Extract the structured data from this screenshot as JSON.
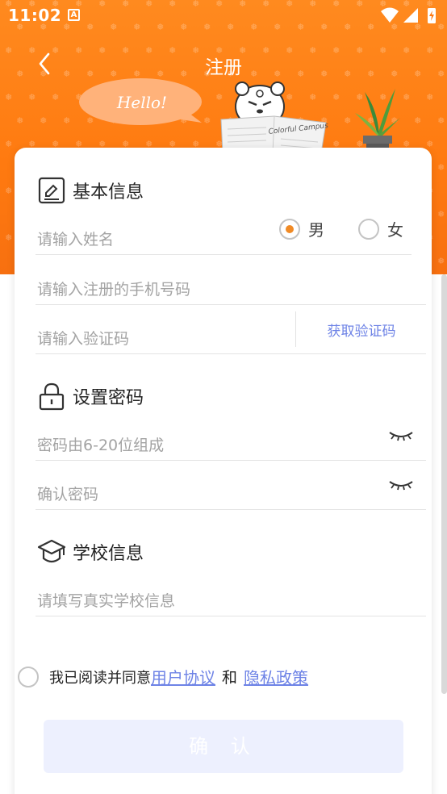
{
  "status_bar": {
    "time": "11:02",
    "app_icon_letter": "A"
  },
  "header": {
    "title": "注册",
    "hello_text": "Hello!",
    "newspaper_text": "Colorful Campus"
  },
  "basic_info": {
    "title": "基本信息",
    "name_placeholder": "请输入姓名",
    "gender_options": [
      "男",
      "女"
    ],
    "gender_selected": "男",
    "phone_placeholder": "请输入注册的手机号码",
    "code_placeholder": "请输入验证码",
    "get_code_label": "获取验证码"
  },
  "password": {
    "title": "设置密码",
    "password_placeholder": "密码由6-20位组成",
    "confirm_placeholder": "确认密码"
  },
  "school": {
    "title": "学校信息",
    "school_placeholder": "请填写真实学校信息"
  },
  "agreement": {
    "prefix": "我已阅读并同意",
    "user_agreement": "用户协议",
    "and": "和",
    "privacy_policy": "隐私政策"
  },
  "confirm_label": "确 认",
  "colors": {
    "brand_orange": "#ff8a1f",
    "link_blue": "#6e83e6",
    "radio_dot": "#f08a25",
    "button_disabled_bg": "#edf0fe"
  }
}
